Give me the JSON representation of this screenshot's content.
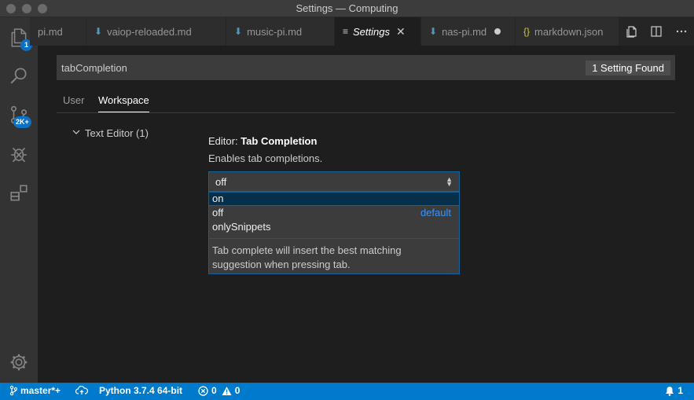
{
  "window": {
    "title": "Settings — Computing"
  },
  "activity": {
    "explorer_badge": "1",
    "scm_badge": "2K+"
  },
  "tabs": [
    {
      "label": "pi.md",
      "icon": "markdown-icon",
      "active": false
    },
    {
      "label": "vaiop-reloaded.md",
      "icon": "markdown-icon",
      "active": false
    },
    {
      "label": "music-pi.md",
      "icon": "markdown-icon",
      "active": false
    },
    {
      "label": "Settings",
      "icon": "settings-lines-icon",
      "active": true
    },
    {
      "label": "nas-pi.md",
      "icon": "markdown-icon",
      "active": false,
      "dirty": true
    },
    {
      "label": "markdown.json",
      "icon": "json-braces-icon",
      "active": false
    }
  ],
  "settings": {
    "search_value": "tabCompletion",
    "found_label": "1 Setting Found",
    "scope_tabs": {
      "user": "User",
      "workspace": "Workspace"
    },
    "tree_item": "Text Editor (1)",
    "setting_prefix": "Editor: ",
    "setting_name": "Tab Completion",
    "setting_desc": "Enables tab completions.",
    "select_value": "off",
    "options": [
      {
        "label": "on",
        "highlighted": true,
        "note": ""
      },
      {
        "label": "off",
        "highlighted": false,
        "note": "default"
      },
      {
        "label": "onlySnippets",
        "highlighted": false,
        "note": ""
      }
    ],
    "option_desc_line1": "Tab complete will insert the best matching",
    "option_desc_line2": "suggestion when pressing tab."
  },
  "statusbar": {
    "branch": "master*+",
    "python": "Python 3.7.4 64-bit",
    "errors": "0",
    "warnings": "0",
    "notifications": "1"
  },
  "colors": {
    "accent": "#007acc",
    "focus_border": "#0e639c",
    "default_link": "#3794ff"
  }
}
